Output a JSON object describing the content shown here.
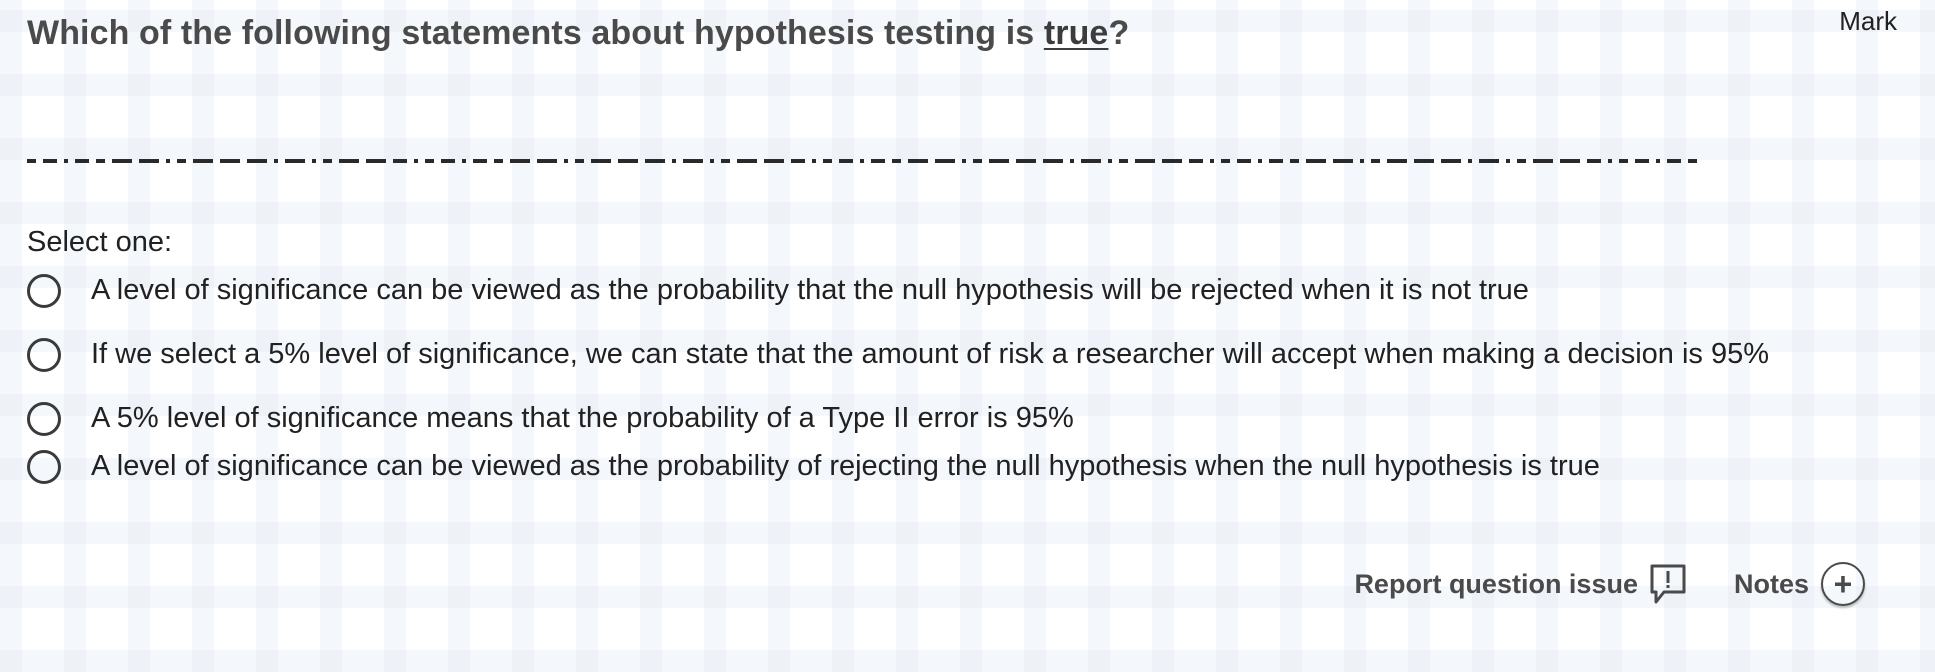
{
  "question": {
    "prefix": "Which of the following statements about hypothesis testing is ",
    "emphasis": "true",
    "suffix": "?"
  },
  "mark_label": "Mark",
  "select_label": "Select one:",
  "options": [
    {
      "text": "A level of significance can be viewed as the probability that the null hypothesis will be rejected when it is not true"
    },
    {
      "text": "If we select a 5% level of significance, we can state that the amount of risk a researcher will accept when making a decision is 95%"
    },
    {
      "text": "A 5% level of significance means that the probability of a Type II error is 95%"
    },
    {
      "text": "A level of significance can be viewed as the probability of rejecting the null hypothesis when the null hypothesis is true"
    }
  ],
  "footer": {
    "report_label": "Report question issue",
    "report_icon": "report-issue-icon",
    "notes_label": "Notes",
    "notes_icon": "plus-circle-icon"
  },
  "colors": {
    "text": "#212121",
    "heading": "#4a4a4a"
  }
}
